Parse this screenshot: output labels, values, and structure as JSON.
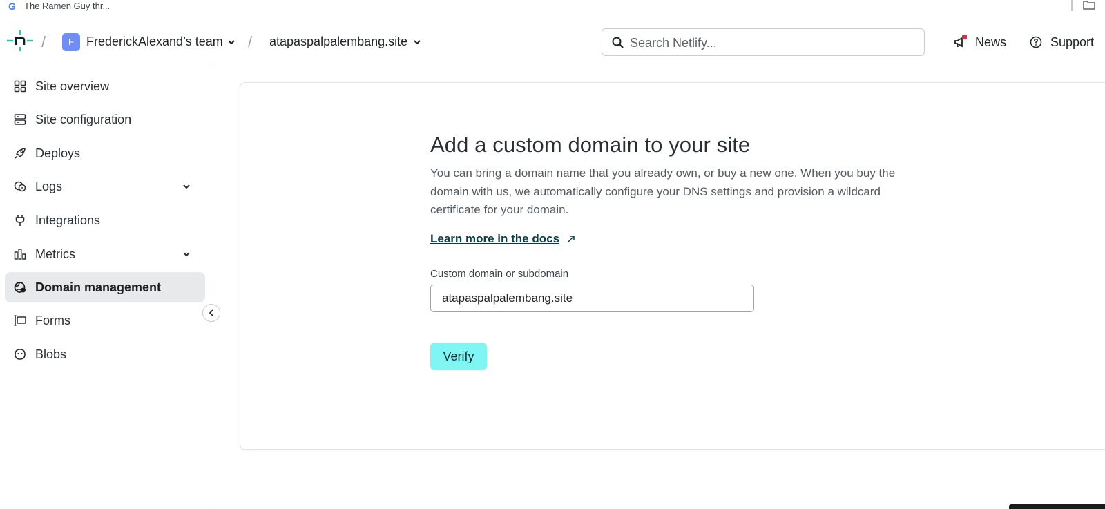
{
  "browser_tab": {
    "favicon": "G",
    "title": "The Ramen Guy thr..."
  },
  "header": {
    "team_initial": "F",
    "team_name": "FrederickAlexand’s team",
    "site_name": "atapaspalpalembang.site",
    "search_placeholder": "Search Netlify...",
    "news_label": "News",
    "support_label": "Support"
  },
  "sidebar": {
    "items": [
      {
        "label": "Site overview",
        "icon": "grid-icon"
      },
      {
        "label": "Site configuration",
        "icon": "settings-list-icon"
      },
      {
        "label": "Deploys",
        "icon": "rocket-icon"
      },
      {
        "label": "Logs",
        "icon": "logs-icon",
        "expandable": true
      },
      {
        "label": "Integrations",
        "icon": "plug-icon"
      },
      {
        "label": "Metrics",
        "icon": "bar-chart-icon",
        "expandable": true
      },
      {
        "label": "Domain management",
        "icon": "globe-icon",
        "active": true
      },
      {
        "label": "Forms",
        "icon": "form-icon"
      },
      {
        "label": "Blobs",
        "icon": "blob-icon"
      }
    ]
  },
  "main": {
    "heading": "Add a custom domain to your site",
    "description": "You can bring a domain name that you already own, or buy a new one. When you buy the domain with us, we automatically configure your DNS settings and provision a wildcard certificate for your domain.",
    "docs_link": "Learn more in the docs",
    "field_label": "Custom domain or subdomain",
    "field_value": "atapaspalpalembang.site",
    "verify_label": "Verify"
  },
  "colors": {
    "accent": "#7ff6f4",
    "brand": "#32c3b4",
    "link": "#0c3f44",
    "active_nav": "#e8e9eb"
  }
}
